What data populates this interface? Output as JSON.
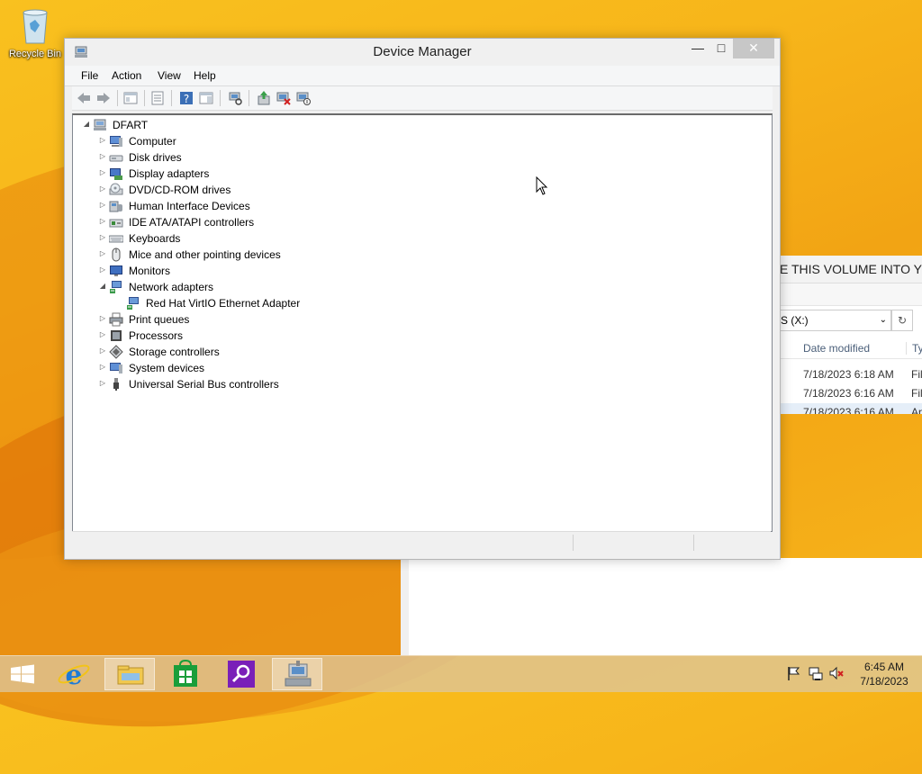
{
  "desktop": {
    "recycle_bin_label": "Recycle Bin"
  },
  "explorer": {
    "banner_text": "E THIS VOLUME INTO YO",
    "address_text": "S (X:)",
    "columns": {
      "date_modified": "Date modified",
      "type": "Ty"
    },
    "rows": [
      {
        "date": "7/18/2023 6:18 AM",
        "type": "Fil",
        "selected": false
      },
      {
        "date": "7/18/2023 6:16 AM",
        "type": "Fil",
        "selected": false
      },
      {
        "date": "7/18/2023 6:16 AM",
        "type": "Ap",
        "selected": true
      }
    ]
  },
  "window": {
    "title": "Device Manager",
    "menu": [
      "File",
      "Action",
      "View",
      "Help"
    ],
    "toolbar_icons": [
      "back-arrow-icon",
      "forward-arrow-icon",
      "show-hide-console-tree-icon",
      "properties-icon",
      "help-icon",
      "action-pane-icon",
      "scan-hardware-icon",
      "update-driver-icon",
      "uninstall-device-icon",
      "disable-device-icon"
    ]
  },
  "tree": {
    "root": "DFART",
    "items": [
      {
        "label": "Computer",
        "icon": "computer-icon",
        "expanded": false
      },
      {
        "label": "Disk drives",
        "icon": "disk-drive-icon",
        "expanded": false
      },
      {
        "label": "Display adapters",
        "icon": "display-adapter-icon",
        "expanded": false
      },
      {
        "label": "DVD/CD-ROM drives",
        "icon": "dvd-drive-icon",
        "expanded": false
      },
      {
        "label": "Human Interface Devices",
        "icon": "hid-icon",
        "expanded": false
      },
      {
        "label": "IDE ATA/ATAPI controllers",
        "icon": "ide-controller-icon",
        "expanded": false
      },
      {
        "label": "Keyboards",
        "icon": "keyboard-icon",
        "expanded": false
      },
      {
        "label": "Mice and other pointing devices",
        "icon": "mouse-icon",
        "expanded": false
      },
      {
        "label": "Monitors",
        "icon": "monitor-icon",
        "expanded": false
      },
      {
        "label": "Network adapters",
        "icon": "network-adapter-icon",
        "expanded": true,
        "children": [
          {
            "label": "Red Hat VirtIO Ethernet Adapter",
            "icon": "network-adapter-icon"
          }
        ]
      },
      {
        "label": "Print queues",
        "icon": "printer-icon",
        "expanded": false
      },
      {
        "label": "Processors",
        "icon": "processor-icon",
        "expanded": false
      },
      {
        "label": "Storage controllers",
        "icon": "storage-controller-icon",
        "expanded": false
      },
      {
        "label": "System devices",
        "icon": "system-devices-icon",
        "expanded": false
      },
      {
        "label": "Universal Serial Bus controllers",
        "icon": "usb-icon",
        "expanded": false
      }
    ]
  },
  "taskbar": {
    "apps": [
      "start-icon",
      "internet-explorer-icon",
      "file-explorer-icon",
      "store-icon",
      "search-app-icon",
      "device-manager-taskbar-icon"
    ],
    "tray": [
      "action-center-flag-icon",
      "network-tray-icon",
      "volume-muted-icon"
    ],
    "time": "6:45 AM",
    "date": "7/18/2023"
  },
  "colors": {
    "wallpaper": "#f7b51a",
    "taskbar": "#dcc8a0",
    "close_button": "#c7c7c7"
  }
}
